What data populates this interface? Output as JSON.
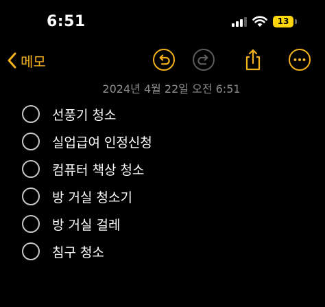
{
  "status_bar": {
    "time": "6:51",
    "battery_level": "13",
    "signal_icon": "cellular-signal-icon",
    "wifi_icon": "wifi-icon",
    "battery_icon": "battery-icon"
  },
  "nav": {
    "back_label": "메모",
    "back_icon": "chevron-left-icon",
    "undo_icon": "undo-icon",
    "redo_icon": "redo-icon",
    "share_icon": "share-icon",
    "more_icon": "ellipsis-icon",
    "accent_color": "#f5b21c"
  },
  "note": {
    "timestamp": "2024년 4월 22일 오전 6:51",
    "items": [
      {
        "label": "선풍기 청소",
        "checked": false
      },
      {
        "label": "실업급여 인정신청",
        "checked": false
      },
      {
        "label": "컴퓨터 책상 청소",
        "checked": false
      },
      {
        "label": "방 거실 청소기",
        "checked": false
      },
      {
        "label": "방 거실 걸레",
        "checked": false
      },
      {
        "label": "침구 청소",
        "checked": false
      }
    ]
  }
}
